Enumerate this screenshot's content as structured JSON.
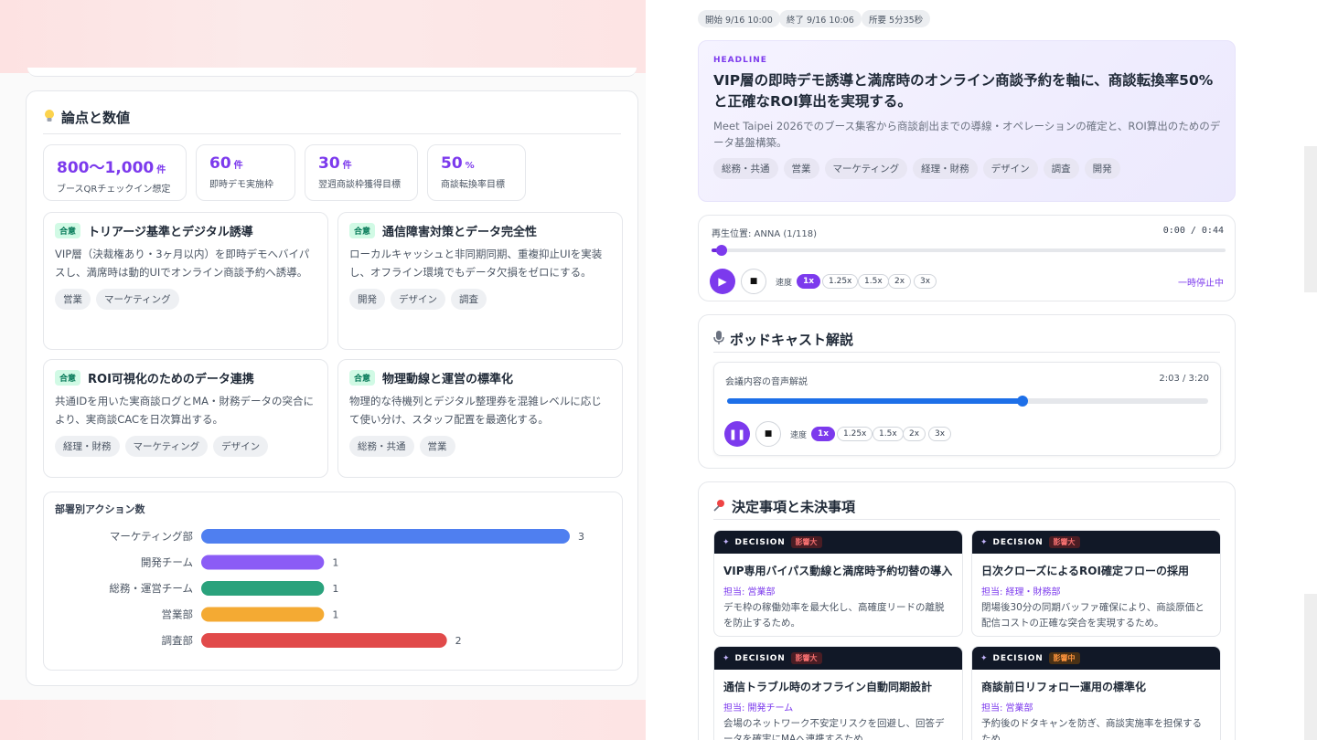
{
  "points": {
    "title": "論点と数値",
    "icon": "lightbulb-icon",
    "metrics": [
      {
        "value": "800〜1,000",
        "unit": "件",
        "label": "ブースQRチェックイン想定"
      },
      {
        "value": "60",
        "unit": "件",
        "label": "即時デモ実施枠"
      },
      {
        "value": "30",
        "unit": "件",
        "label": "翌週商談枠獲得目標"
      },
      {
        "value": "50",
        "unit": "%",
        "label": "商談転換率目標"
      }
    ],
    "topics": [
      {
        "badge": "合意",
        "title": "トリアージ基準とデジタル誘導",
        "body": "VIP層（決裁権あり・3ヶ月以内）を即時デモへバイパスし、満席時は動的UIでオンライン商談予約へ誘導。",
        "tags": [
          "営業",
          "マーケティング"
        ]
      },
      {
        "badge": "合意",
        "title": "通信障害対策とデータ完全性",
        "body": "ローカルキャッシュと非同期同期、重複抑止UIを実装し、オフライン環境でもデータ欠損をゼロにする。",
        "tags": [
          "開発",
          "デザイン",
          "調査"
        ]
      },
      {
        "badge": "合意",
        "title": "ROI可視化のためのデータ連携",
        "body": "共通IDを用いた実商談ログとMA・財務データの突合により、実商談CACを日次算出する。",
        "tags": [
          "経理・財務",
          "マーケティング",
          "デザイン"
        ]
      },
      {
        "badge": "合意",
        "title": "物理動線と運営の標準化",
        "body": "物理的な待機列とデジタル整理券を混雑レベルに応じて使い分け、スタッフ配置を最適化する。",
        "tags": [
          "総務・共通",
          "営業"
        ]
      }
    ]
  },
  "chart_data": {
    "type": "bar",
    "orientation": "horizontal",
    "title": "部署別アクション数",
    "categories": [
      "マーケティング部",
      "開発チーム",
      "総務・運営チーム",
      "営業部",
      "調査部"
    ],
    "values": [
      3,
      1,
      1,
      1,
      2
    ],
    "colors": [
      "#4f7ff0",
      "#8b5cf6",
      "#2aa27c",
      "#f4aa33",
      "#e14a4a"
    ],
    "xlim": [
      0,
      3
    ],
    "grid": false
  },
  "meta": {
    "start": "開始 9/16 10:00",
    "end": "終了 9/16 10:06",
    "duration": "所要 5分35秒"
  },
  "headline": {
    "kicker": "HEADLINE",
    "text": "VIP層の即時デモ誘導と満席時のオンライン商談予約を軸に、商談転換率50%と正確なROI算出を実現する。",
    "sub": "Meet Taipei 2026でのブース集客から商談創出までの導線・オペレーションの確定と、ROI算出のためのデータ基盤構築。",
    "tags": [
      "総務・共通",
      "営業",
      "マーケティング",
      "経理・財務",
      "デザイン",
      "調査",
      "開発"
    ]
  },
  "player": {
    "position_label": "再生位置: ANNA (1/118)",
    "time": "0:00 / 0:44",
    "progress": 0.02,
    "speed_label": "速度",
    "speeds": [
      "1x",
      "1.25x",
      "1.5x",
      "2x",
      "3x"
    ],
    "status": "一時停止中"
  },
  "podcast": {
    "title": "ポッドキャスト解説",
    "icon": "microphone-icon",
    "label": "会議内容の音声解説",
    "time": "2:03 / 3:20",
    "progress": 0.615,
    "speed_label": "速度",
    "speeds": [
      "1x",
      "1.25x",
      "1.5x",
      "2x",
      "3x"
    ]
  },
  "decisions": {
    "title": "決定事項と未決事項",
    "icon": "pushpin-icon",
    "items": [
      {
        "label": "DECISION",
        "impact": "影響大",
        "title": "VIP専用バイパス動線と満席時予約切替の導入",
        "owner": "担当: 営業部",
        "body": "デモ枠の稼働効率を最大化し、高確度リードの離脱を防止するため。"
      },
      {
        "label": "DECISION",
        "impact": "影響大",
        "title": "日次クローズによるROI確定フローの採用",
        "owner": "担当: 経理・財務部",
        "body": "閉場後30分の同期バッファ確保により、商談原価と配信コストの正確な突合を実現するため。"
      },
      {
        "label": "DECISION",
        "impact": "影響大",
        "title": "通信トラブル時のオフライン自動同期設計",
        "owner": "担当: 開発チーム",
        "body": "会場のネットワーク不安定リスクを回避し、回答データを確実にMAへ連携するため。"
      },
      {
        "label": "DECISION",
        "impact": "影響中",
        "title": "商談前日リフォロー運用の標準化",
        "owner": "担当: 営業部",
        "body": "予約後のドタキャンを防ぎ、商談実施率を担保するため。"
      }
    ]
  }
}
